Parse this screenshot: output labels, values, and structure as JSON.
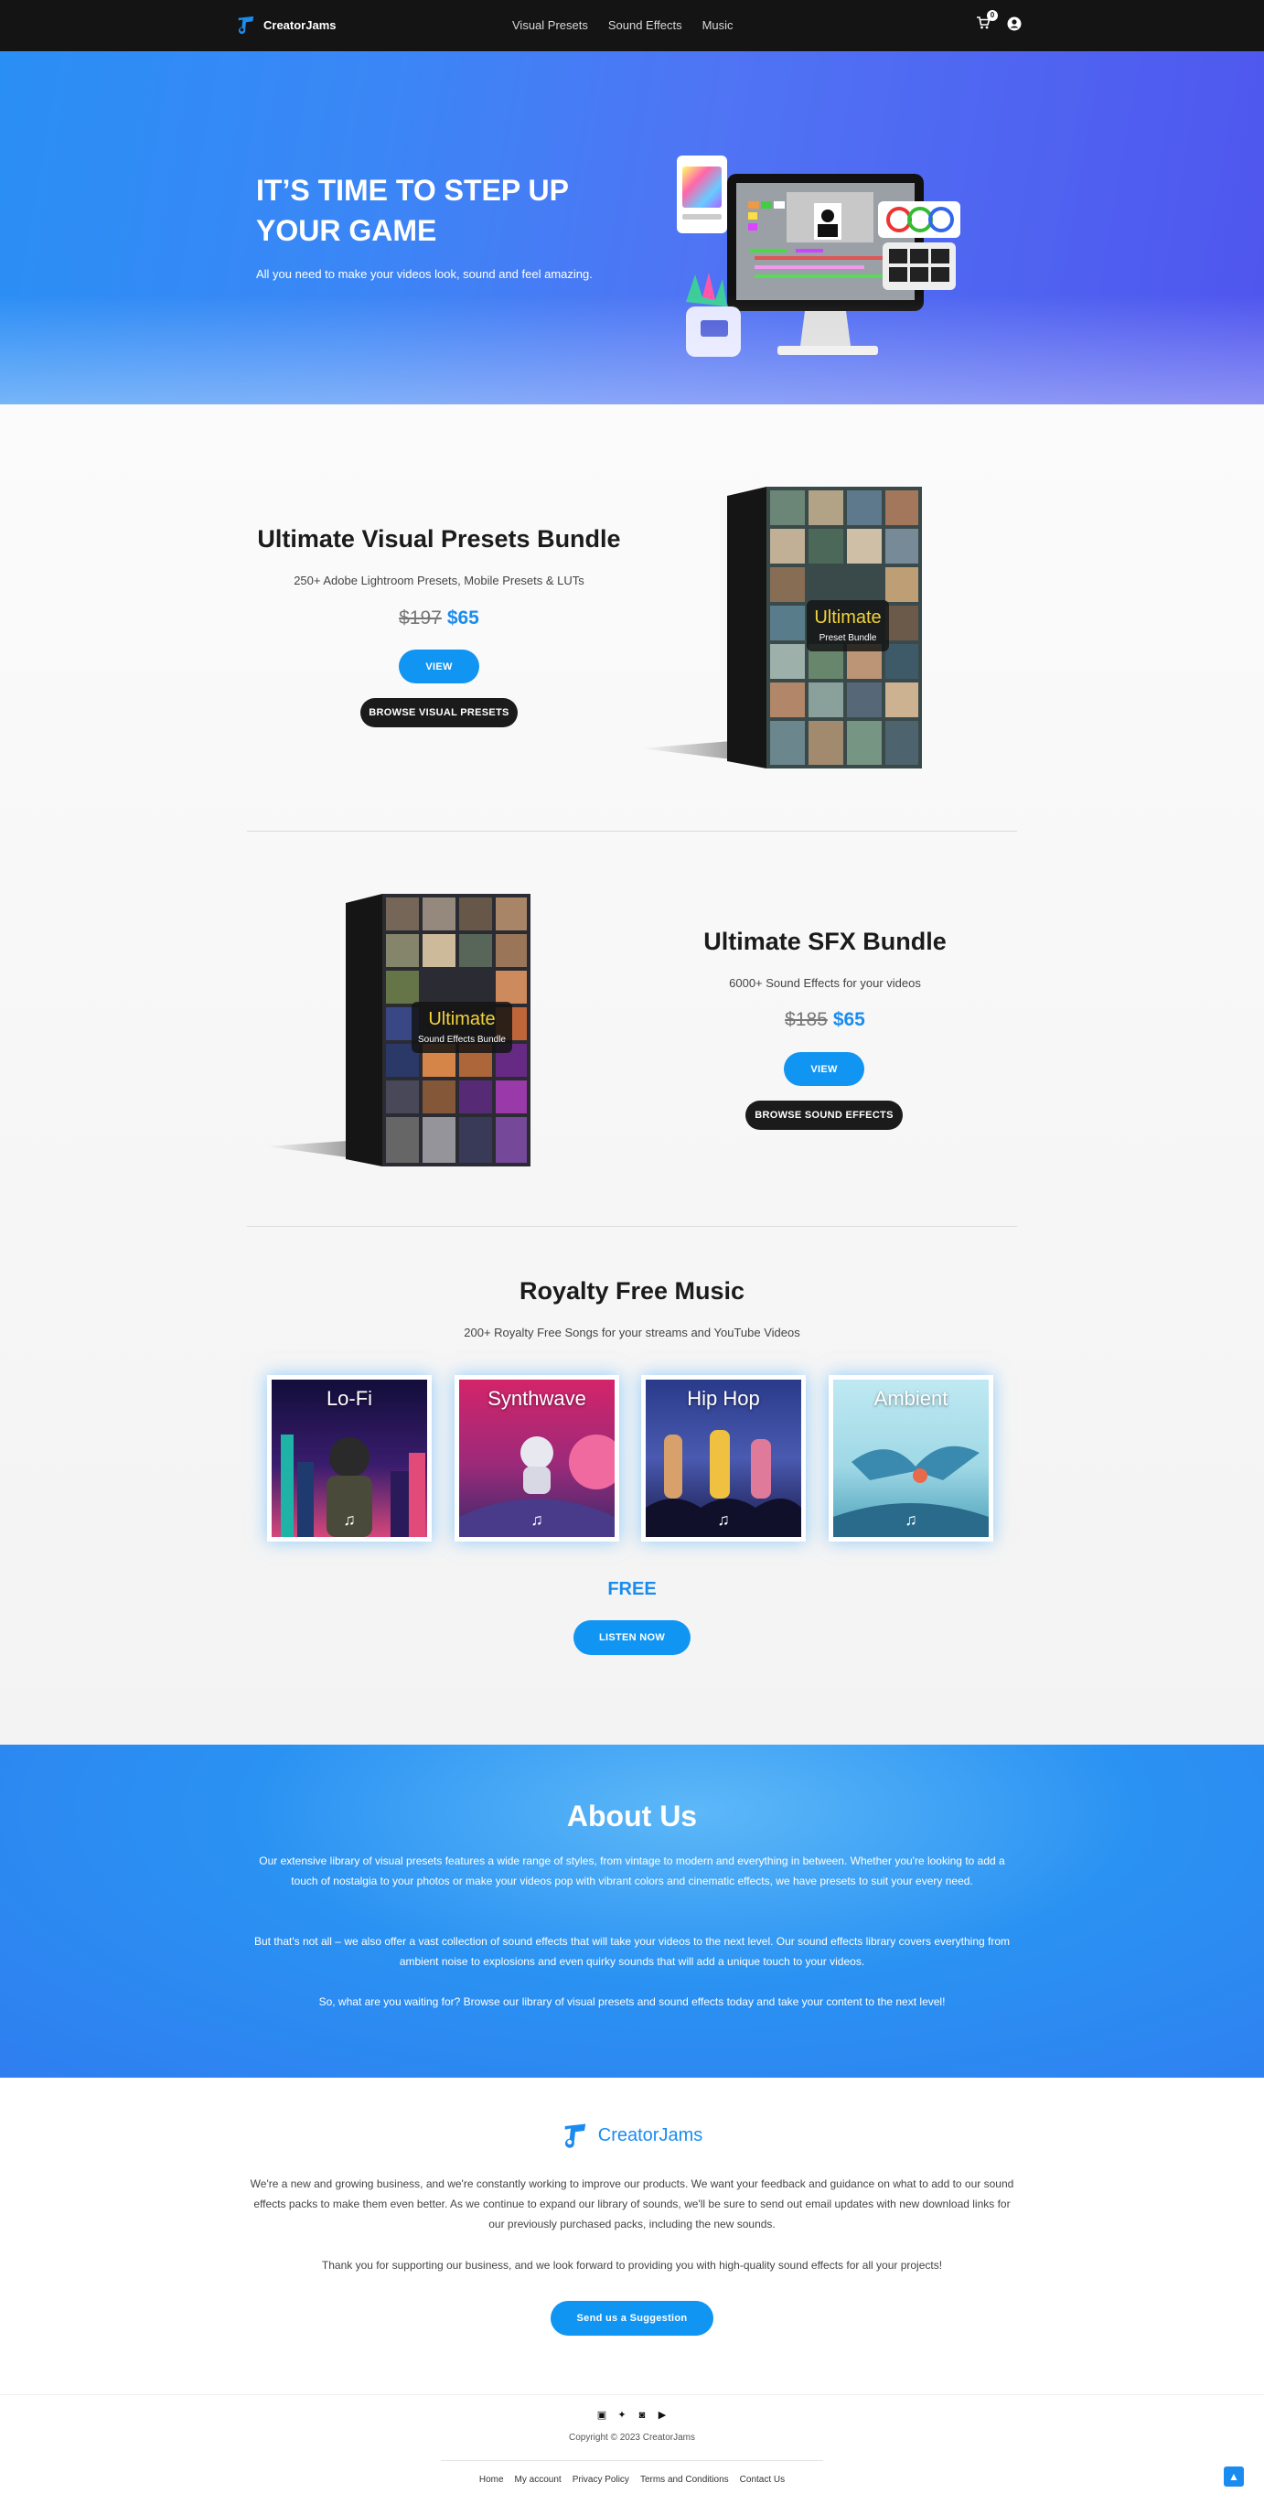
{
  "nav": {
    "brand": "CreatorJams",
    "links": [
      "Visual Presets",
      "Sound Effects",
      "Music"
    ],
    "cart_count": "0"
  },
  "hero": {
    "title": "IT’S TIME TO STEP UP YOUR GAME",
    "subtitle": "All you need to make your videos look, sound and feel amazing."
  },
  "visual_bundle": {
    "title": "Ultimate Visual Presets Bundle",
    "description": "250+ Adobe Lightroom Presets, Mobile Presets & LUTs",
    "old_price": "$197",
    "new_price": "$65",
    "view_label": "VIEW",
    "browse_label": "BROWSE VISUAL PRESETS",
    "box_title": "Ultimate",
    "box_sub": "Preset Bundle"
  },
  "sfx_bundle": {
    "title": "Ultimate SFX Bundle",
    "description": "6000+ Sound Effects for your videos",
    "old_price": "$185",
    "new_price": "$65",
    "view_label": "VIEW",
    "browse_label": "BROWSE SOUND EFFECTS",
    "box_title": "Ultimate",
    "box_sub": "Sound Effects Bundle"
  },
  "music": {
    "title": "Royalty Free Music",
    "description": "200+ Royalty Free Songs for your streams and YouTube Videos",
    "genres": [
      "Lo-Fi",
      "Synthwave",
      "Hip Hop",
      "Ambient"
    ],
    "price_label": "FREE",
    "listen_label": "LISTEN NOW"
  },
  "about": {
    "title": "About Us",
    "paragraphs": [
      "Our extensive library of visual presets features a wide range of styles, from vintage to modern and everything in between. Whether you're looking to add a touch of nostalgia to your photos or make your videos pop with vibrant colors and cinematic effects, we have presets to suit your every need.",
      "But that's not all – we also offer a vast collection of sound effects that will take your videos to the next level. Our sound effects library covers everything from ambient noise to explosions and even quirky sounds that will add a unique touch to your videos.",
      "So, what are you waiting for? Browse our library of visual presets and sound effects today and take your content to the next level!"
    ]
  },
  "bottom": {
    "brand": "CreatorJams",
    "paragraphs": [
      "We're a new and growing business, and we're constantly working to improve our products. We want your feedback and guidance on what to add to our sound effects packs to make them even better. As we continue to expand our library of sounds, we'll be sure to send out email updates with new download links for our previously purchased packs, including the new sounds.",
      "Thank you for supporting our business, and we look forward to providing you with high-quality sound effects for all your projects!"
    ],
    "suggestion_label": "Send us a Suggestion"
  },
  "footer": {
    "copyright": "Copyright © 2023 CreatorJams",
    "links": [
      "Home",
      "My account",
      "Privacy Policy",
      "Terms and Conditions",
      "Contact Us"
    ]
  },
  "colors": {
    "accent": "#1195f2",
    "nav_bg": "#141414",
    "dark_button": "#1b1b1b"
  }
}
